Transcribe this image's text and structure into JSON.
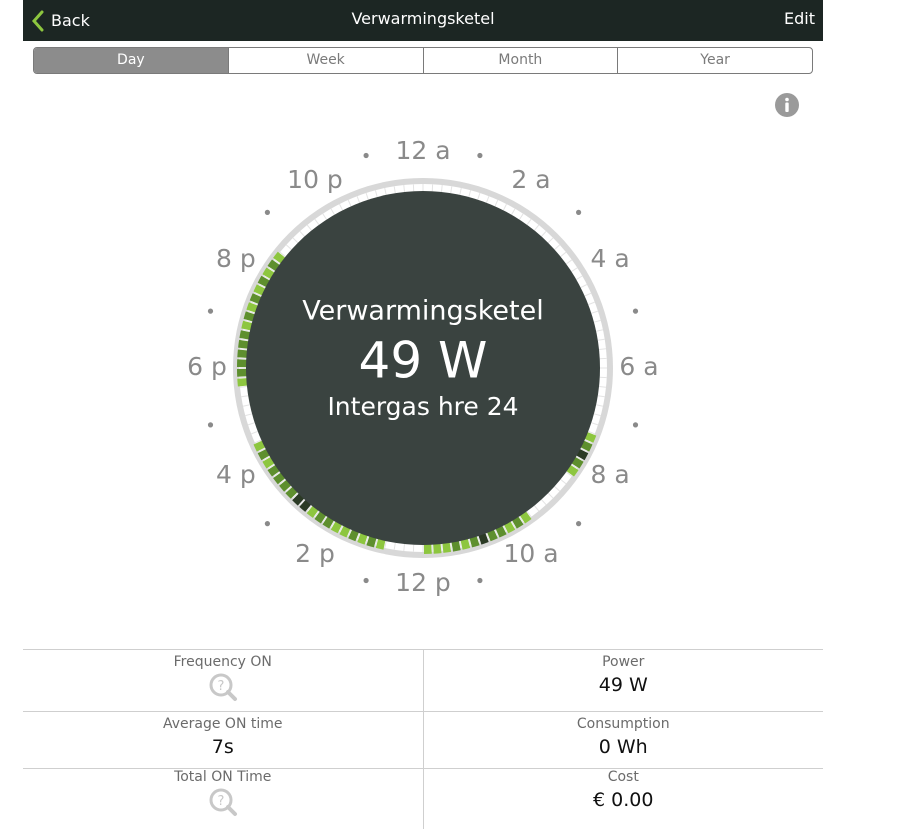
{
  "header": {
    "back_label": "Back",
    "title": "Verwarmingsketel",
    "edit_label": "Edit"
  },
  "tabs": [
    {
      "label": "Day",
      "active": true
    },
    {
      "label": "Week",
      "active": false
    },
    {
      "label": "Month",
      "active": false
    },
    {
      "label": "Year",
      "active": false
    }
  ],
  "clock": {
    "device_name": "Verwarmingsketel",
    "power_value": "49 W",
    "device_model": "Intergas hre 24",
    "hour_labels": [
      {
        "text": "12 a",
        "hour": 0
      },
      {
        "text": "2 a",
        "hour": 2
      },
      {
        "text": "4 a",
        "hour": 4
      },
      {
        "text": "6 a",
        "hour": 6
      },
      {
        "text": "8 a",
        "hour": 8
      },
      {
        "text": "10 a",
        "hour": 10
      },
      {
        "text": "12 p",
        "hour": 12
      },
      {
        "text": "2 p",
        "hour": 14
      },
      {
        "text": "4 p",
        "hour": 16
      },
      {
        "text": "6 p",
        "hour": 18
      },
      {
        "text": "8 p",
        "hour": 20
      },
      {
        "text": "10 p",
        "hour": 22
      }
    ],
    "usage_segments": [
      {
        "hour": 7.4,
        "level": "light"
      },
      {
        "hour": 7.6,
        "level": "mid"
      },
      {
        "hour": 7.8,
        "level": "dark"
      },
      {
        "hour": 8.0,
        "level": "mid"
      },
      {
        "hour": 8.2,
        "level": "light"
      },
      {
        "hour": 9.6,
        "level": "light"
      },
      {
        "hour": 9.8,
        "level": "mid"
      },
      {
        "hour": 10.0,
        "level": "light"
      },
      {
        "hour": 10.2,
        "level": "mid"
      },
      {
        "hour": 10.4,
        "level": "mid"
      },
      {
        "hour": 10.6,
        "level": "dark"
      },
      {
        "hour": 10.8,
        "level": "mid"
      },
      {
        "hour": 11.0,
        "level": "light"
      },
      {
        "hour": 11.2,
        "level": "mid"
      },
      {
        "hour": 11.4,
        "level": "light"
      },
      {
        "hour": 11.6,
        "level": "light"
      },
      {
        "hour": 11.8,
        "level": "light"
      },
      {
        "hour": 12.8,
        "level": "light"
      },
      {
        "hour": 13.0,
        "level": "mid"
      },
      {
        "hour": 13.2,
        "level": "light"
      },
      {
        "hour": 13.4,
        "level": "mid"
      },
      {
        "hour": 13.6,
        "level": "light"
      },
      {
        "hour": 13.8,
        "level": "light"
      },
      {
        "hour": 14.0,
        "level": "mid"
      },
      {
        "hour": 14.2,
        "level": "mid"
      },
      {
        "hour": 14.4,
        "level": "light"
      },
      {
        "hour": 14.6,
        "level": "dark"
      },
      {
        "hour": 14.8,
        "level": "dark"
      },
      {
        "hour": 15.0,
        "level": "mid"
      },
      {
        "hour": 15.2,
        "level": "mid"
      },
      {
        "hour": 15.4,
        "level": "mid"
      },
      {
        "hour": 15.6,
        "level": "mid"
      },
      {
        "hour": 15.8,
        "level": "light"
      },
      {
        "hour": 16.0,
        "level": "mid"
      },
      {
        "hour": 16.2,
        "level": "light"
      },
      {
        "hour": 17.6,
        "level": "light"
      },
      {
        "hour": 17.8,
        "level": "mid"
      },
      {
        "hour": 18.0,
        "level": "mid"
      },
      {
        "hour": 18.2,
        "level": "mid"
      },
      {
        "hour": 18.4,
        "level": "mid"
      },
      {
        "hour": 18.6,
        "level": "mid"
      },
      {
        "hour": 18.8,
        "level": "light"
      },
      {
        "hour": 19.0,
        "level": "mid"
      },
      {
        "hour": 19.2,
        "level": "light"
      },
      {
        "hour": 19.4,
        "level": "mid"
      },
      {
        "hour": 19.6,
        "level": "light"
      },
      {
        "hour": 19.8,
        "level": "mid"
      },
      {
        "hour": 20.0,
        "level": "light"
      },
      {
        "hour": 20.2,
        "level": "mid"
      },
      {
        "hour": 20.4,
        "level": "light"
      }
    ],
    "colors": {
      "face": "#3a4340",
      "light": "#8dc63f",
      "mid": "#5e8f2e",
      "dark": "#2b3a25",
      "ring": "#d8d8d8",
      "label": "#8a8a8a"
    }
  },
  "stats": {
    "rows": [
      {
        "left": {
          "label": "Frequency ON",
          "value": "",
          "icon": "help-search-icon"
        },
        "right": {
          "label": "Power",
          "value": "49 W"
        }
      },
      {
        "left": {
          "label": "Average ON time",
          "value": "7s"
        },
        "right": {
          "label": "Consumption",
          "value": "0 Wh"
        }
      },
      {
        "left": {
          "label": "Total ON Time",
          "value": "",
          "icon": "help-search-icon"
        },
        "right": {
          "label": "Cost",
          "value": "€ 0.00"
        }
      }
    ]
  }
}
